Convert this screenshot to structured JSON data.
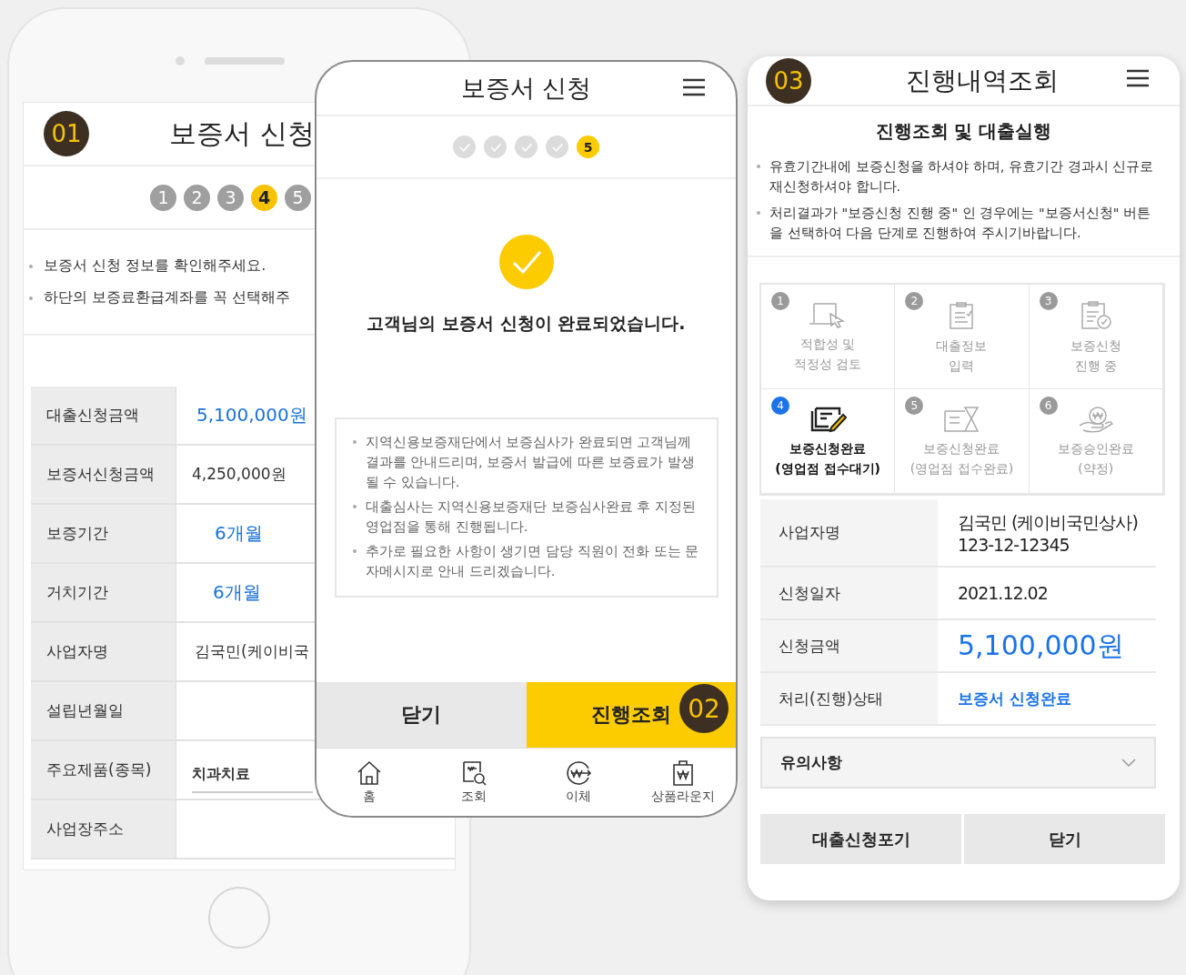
{
  "screen_1": {
    "badge": "01",
    "title": "보증서 신청",
    "steps": [
      {
        "label": "1",
        "selected": false
      },
      {
        "label": "2",
        "selected": false
      },
      {
        "label": "3",
        "selected": false
      },
      {
        "label": "4",
        "selected": true
      },
      {
        "label": "5",
        "selected": false
      }
    ],
    "notes": [
      "보증서 신청 정보를 확인해주세요.",
      "하단의 보증료환급계좌를 꼭 선택해주"
    ],
    "rows": [
      {
        "label": "대출신청금액",
        "value": "5,100,000원",
        "kind": "highlight"
      },
      {
        "label": "보증서신청금액",
        "value": "4,250,000원",
        "kind": "plain"
      },
      {
        "label": "보증기간",
        "value": "6개월",
        "kind": "highlight"
      },
      {
        "label": "거치기간",
        "value": "6개월",
        "kind": "highlight"
      },
      {
        "label": "사업자명",
        "value": "김국민(케이비국",
        "kind": "plain"
      },
      {
        "label": "설립년월일",
        "kind": "plain"
      },
      {
        "label": "주요제품(종목)",
        "value": "치과치료",
        "kind": "input"
      },
      {
        "label": "사업장주소",
        "kind": "plain"
      }
    ]
  },
  "screen_2": {
    "badge": "02",
    "title": "보증서 신청",
    "steps": [
      {
        "done": true,
        "selected": false
      },
      {
        "done": true,
        "selected": false
      },
      {
        "done": true,
        "selected": false
      },
      {
        "done": true,
        "selected": false
      },
      {
        "label": "5",
        "done": false,
        "selected": true
      }
    ],
    "message": "고객님의 보증서 신청이 완료되었습니다.",
    "notes": [
      "지역신용보증재단에서 보증심사가 완료되면 고객님께 결과를 안내드리며, 보증서 발급에 따른 보증료가 발생될 수 있습니다.",
      "대출심사는 지역신용보증재단 보증심사완료 후 지정된 영업점을 통해 진행됩니다.",
      "추가로 필요한 사항이 생기면 담당 직원이 전화 또는 문자메시지로 안내 드리겠습니다."
    ],
    "buttons": [
      {
        "label": "닫기",
        "kind": "secondary"
      },
      {
        "label": "진행조회",
        "kind": "primary"
      }
    ],
    "nav": [
      {
        "label": "홈",
        "kind": "home"
      },
      {
        "label": "조회",
        "kind": "search"
      },
      {
        "label": "이체",
        "kind": "transfer"
      },
      {
        "label": "상품라운지",
        "kind": "bag"
      }
    ]
  },
  "screen_3": {
    "badge": "03",
    "title": "진행내역조회",
    "heading": "진행조회 및 대출실행",
    "notes": [
      "유효기간내에 보증신청을 하셔야 하며, 유효기간 경과시 신규로 재신청하셔야 합니다.",
      "처리결과가 \"보증신청 진행 중\" 인 경우에는 \"보증서신청\" 버튼을 선택하여 다음 단계로 진행하여 주시기바랍니다."
    ],
    "stages": [
      {
        "number": "1",
        "label": "적합성 및\n적정성 검토",
        "kind": "laptop",
        "selected": false
      },
      {
        "number": "2",
        "label": "대출정보\n입력",
        "kind": "clipboard",
        "selected": false
      },
      {
        "number": "3",
        "label": "보증신청\n진행 중",
        "kind": "check-doc",
        "selected": false
      },
      {
        "number": "4",
        "label": "보증신청완료\n(영업점 접수대기)",
        "kind": "pen",
        "selected": true
      },
      {
        "number": "5",
        "label": "보증신청완료\n(영업점 접수완료)",
        "kind": "hourglass",
        "selected": false
      },
      {
        "number": "6",
        "label": "보증승인완료\n(약정)",
        "kind": "hand",
        "selected": false
      }
    ],
    "rows": [
      {
        "label": "사업자명",
        "value": "김국민 (케이비국민상사)",
        "sub": "123-12-12345",
        "kind": "plain"
      },
      {
        "label": "신청일자",
        "value": "2021.12.02",
        "kind": "plain"
      },
      {
        "label": "신청금액",
        "value": "5,100,000원",
        "kind": "amount"
      },
      {
        "label": "처리(진행)상태",
        "value": "보증서 신청완료",
        "kind": "status"
      }
    ],
    "accordion": {
      "label": "유의사항",
      "expanded": false
    },
    "buttons": [
      "대출신청포기",
      "닫기"
    ]
  }
}
